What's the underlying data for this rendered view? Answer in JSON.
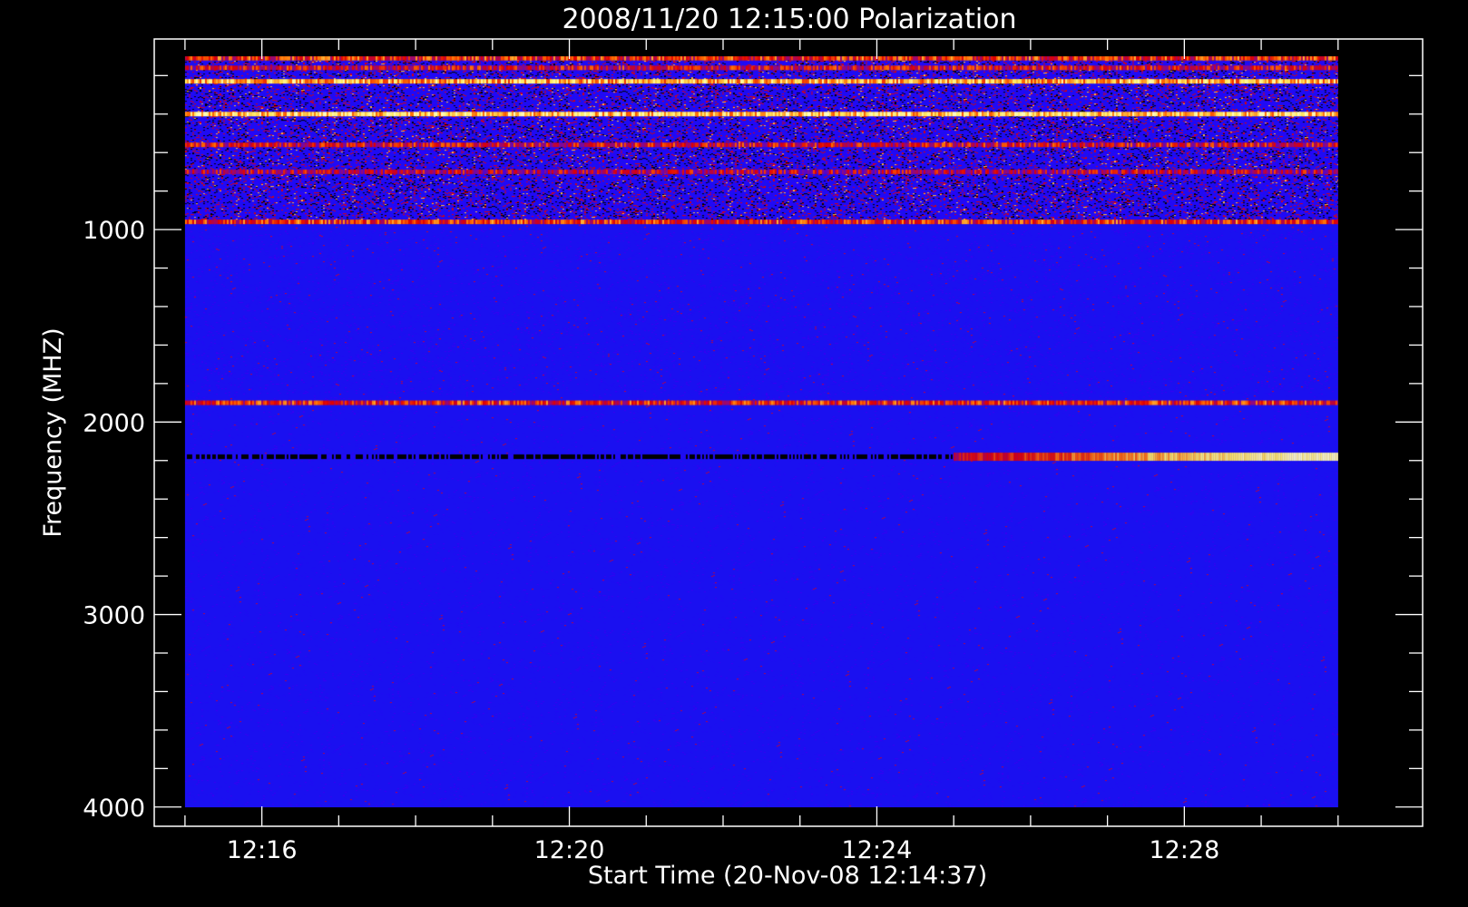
{
  "chart_data": {
    "type": "heatmap",
    "title": "2008/11/20 12:15:00 Polarization",
    "xlabel": "Start Time (20-Nov-08 12:14:37)",
    "ylabel": "Frequency (MHZ)",
    "x_tick_labels": [
      "12:16",
      "12:20",
      "12:24",
      "12:28"
    ],
    "x_tick_minutes": [
      16,
      20,
      24,
      28
    ],
    "xlim_minutes": [
      14.6,
      31.1
    ],
    "data_x_minutes": [
      15.0,
      30.0
    ],
    "y_tick_labels": [
      "1000",
      "2000",
      "3000",
      "4000"
    ],
    "y_tick_values": [
      1000,
      2000,
      3000,
      4000
    ],
    "ylim_mhz": [
      4100,
      10
    ],
    "data_y_mhz": [
      100,
      4000
    ],
    "y_reversed": true,
    "colormap": [
      "#000000",
      "#1a10f0",
      "#2b00ff",
      "#8a0a8a",
      "#e00000",
      "#ff6a00",
      "#ffe860",
      "#fffcc0"
    ],
    "background_color": "#1a10f0",
    "bands": [
      {
        "mhz": 110,
        "t0": 15.0,
        "t1": 30.0,
        "level": 0.62
      },
      {
        "mhz": 160,
        "t0": 15.0,
        "t1": 30.0,
        "level": 0.55
      },
      {
        "mhz": 230,
        "t0": 15.0,
        "t1": 30.0,
        "level": 0.8
      },
      {
        "mhz": 400,
        "t0": 15.0,
        "t1": 30.0,
        "level": 0.85
      },
      {
        "mhz": 560,
        "t0": 15.0,
        "t1": 30.0,
        "level": 0.55
      },
      {
        "mhz": 700,
        "t0": 15.0,
        "t1": 30.0,
        "level": 0.5
      },
      {
        "mhz": 960,
        "t0": 15.0,
        "t1": 30.0,
        "level": 0.62
      },
      {
        "mhz": 1900,
        "t0": 15.0,
        "t1": 30.0,
        "level": 0.6
      },
      {
        "mhz": 2180,
        "t0": 15.0,
        "t1": 25.0,
        "level": 0.02
      },
      {
        "mhz": 2180,
        "t0": 25.0,
        "t1": 30.0,
        "level": 0.96
      }
    ]
  }
}
